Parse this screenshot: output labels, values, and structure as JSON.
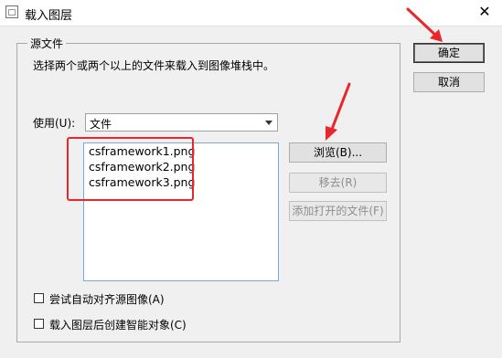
{
  "window": {
    "title": "载入图层"
  },
  "source_group": {
    "legend": "源文件",
    "description": "选择两个或两个以上的文件来载入到图像堆栈中。",
    "use_label": "使用(U):",
    "use_value": "文件",
    "files": [
      "csframework1.png",
      "csframework2.png",
      "csframework3.png"
    ]
  },
  "buttons": {
    "browse": "浏览(B)...",
    "remove": "移去(R)",
    "add_open": "添加打开的文件(F)",
    "ok": "确定",
    "cancel": "取消"
  },
  "options": {
    "auto_align": "尝试自动对齐源图像(A)",
    "smart_object": "载入图层后创建智能对象(C)"
  },
  "colors": {
    "annotation": "#e8262b"
  }
}
